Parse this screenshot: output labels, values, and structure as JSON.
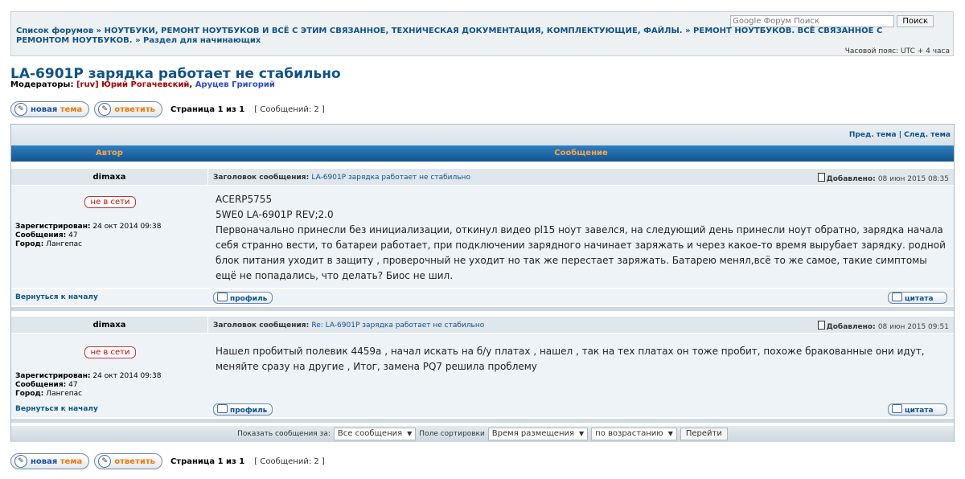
{
  "search": {
    "placeholder": "Google Форум Поиск",
    "button": "Поиск"
  },
  "breadcrumbs": {
    "items": [
      "Список форумов",
      "НОУТБУКИ, РЕМОНТ НОУТБУКОВ И ВСЁ С ЭТИМ СВЯЗАННОЕ, ТЕХНИЧЕСКАЯ ДОКУМЕНТАЦИЯ, КОМПЛЕКТУЮЩИЕ, ФАЙЛЫ.",
      "РЕМОНТ НОУТБУКОВ. ВСЁ СВЯЗАННОЕ С РЕМОНТОМ НОУТБУКОВ.",
      "Раздел для начинающих"
    ],
    "separator": "»"
  },
  "timezone": "Часовой пояс: UTC + 4 часа",
  "topic": {
    "title": "LA-6901P зарядка работает не стабильно",
    "moderators_label": "Модераторы:",
    "moderator_1": "[ruv] Юрий Рогачевский",
    "moderator_2": "Аруцев Григорий"
  },
  "buttons": {
    "new_topic_1": "новая",
    "new_topic_2": "тема",
    "reply": "ответить",
    "profile": "профиль",
    "quote": "цитата",
    "go": "Перейти"
  },
  "pagination": {
    "page": "Страница 1 из 1",
    "count": "[ Сообщений: 2 ]"
  },
  "topnav": {
    "prev": "Пред. тема",
    "sep": "|",
    "next": "След. тема"
  },
  "columns": {
    "author": "Автор",
    "message": "Сообщение"
  },
  "posts": [
    {
      "author": "dimaxa",
      "status": "не в сети",
      "subject_label": "Заголовок сообщения:",
      "subject": "LA-6901P зарядка работает не стабильно",
      "added_label": "Добавлено:",
      "added": "08 июн 2015 08:35",
      "registered_label": "Зарегистрирован:",
      "registered": "24 окт 2014 09:38",
      "messages_label": "Сообщения:",
      "messages": "47",
      "city_label": "Город:",
      "city": "Лангепас",
      "body_line1": "ACERP5755",
      "body_line2": "5WE0 LA-6901P REV;2.0",
      "body_line3": "Первоначально принесли без инициализации, откинул видео pl15 ноут завелся, на следующий день принесли ноут обратно, зарядка начала себя странно вести, то батареи работает, при подключении зарядного начинает заряжать и через какое-то время вырубает зарядку. родной блок питания уходит в защиту , проверочный не уходит но так же перестает заряжать. Батарею менял,всё то же самое, такие симптомы ещё не попадались, что делать? Биос не шил.",
      "back": "Вернуться к началу"
    },
    {
      "author": "dimaxa",
      "status": "не в сети",
      "subject_label": "Заголовок сообщения:",
      "subject": "Re: LA-6901P зарядка работает не стабильно",
      "added_label": "Добавлено:",
      "added": "08 июн 2015 09:51",
      "registered_label": "Зарегистрирован:",
      "registered": "24 окт 2014 09:38",
      "messages_label": "Сообщения:",
      "messages": "47",
      "city_label": "Город:",
      "city": "Лангепас",
      "body_line1": "Нашел пробитый полевик 4459а , начал искать на б/у платах , нашел , так на тех платах он тоже пробит, похоже бракованные они идут, меняйте сразу на другие , Итог, замена PQ7 решила проблему",
      "back": "Вернуться к началу"
    }
  ],
  "sortbar": {
    "show_label": "Показать сообщения за:",
    "show_value": "Все сообщения",
    "sort_label": "Поле сортировки",
    "sort_value": "Время размещения",
    "order_value": "по возрастанию"
  },
  "colors": {
    "link": "#105289",
    "header_bg": "#12548f",
    "header_text": "#ffa34f",
    "offline": "#cc0000"
  }
}
